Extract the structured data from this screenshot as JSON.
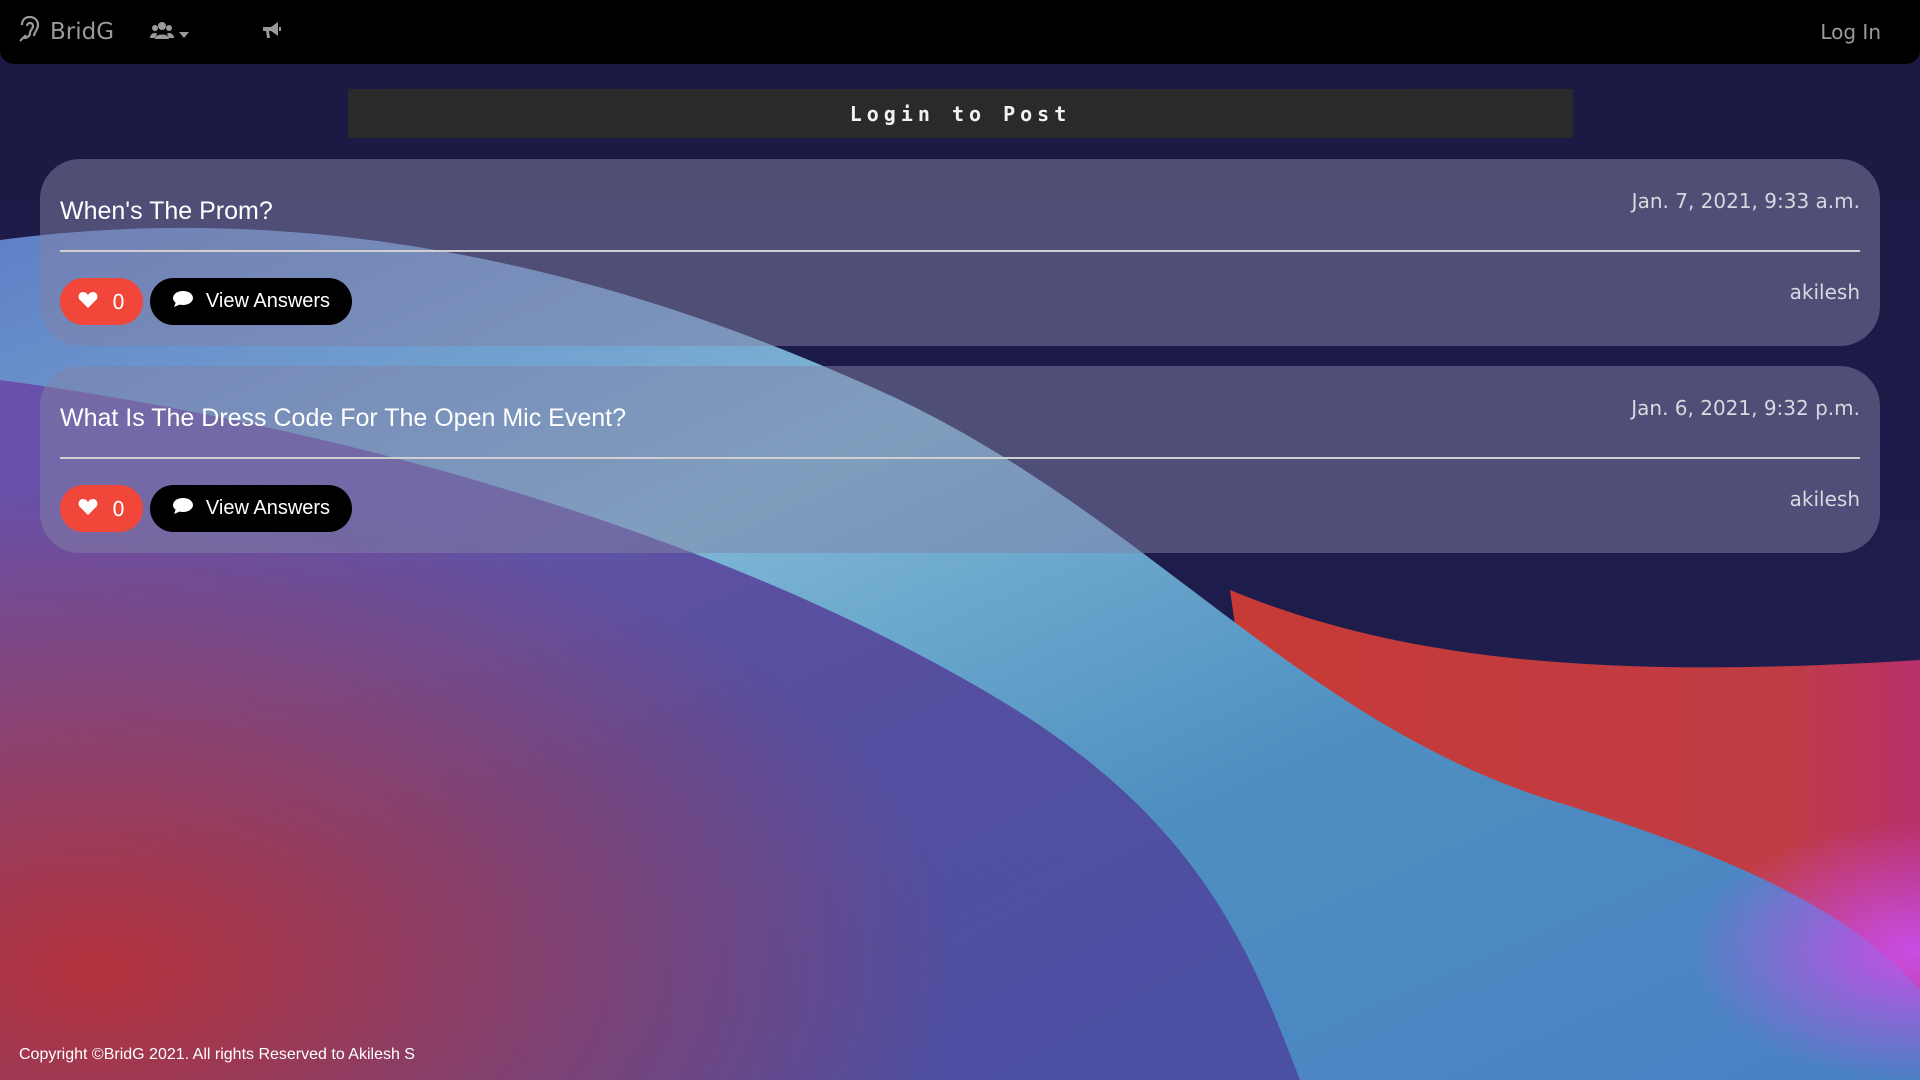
{
  "navbar": {
    "brand": "BridG",
    "login_label": "Log In",
    "icons": [
      "ear-icon",
      "users-icon",
      "caret-down-icon",
      "bullhorn-icon"
    ]
  },
  "post_bar": {
    "label": "Login to Post"
  },
  "questions": [
    {
      "title": "When's The Prom?",
      "date": "Jan. 7, 2021, 9:33 a.m.",
      "author": "akilesh",
      "likes": "0",
      "answers_label": "View Answers"
    },
    {
      "title": "What Is The Dress Code For The Open Mic Event?",
      "date": "Jan. 6, 2021, 9:32 p.m.",
      "author": "akilesh",
      "likes": "0",
      "answers_label": "View Answers"
    }
  ],
  "footer": {
    "copyright": "Copyright ©BridG 2021. All rights Reserved to Akilesh S"
  },
  "colors": {
    "like_button": "#f0473a",
    "answers_button": "#000000",
    "navbar": "#000000",
    "post_bar": "#2a2a2a"
  }
}
